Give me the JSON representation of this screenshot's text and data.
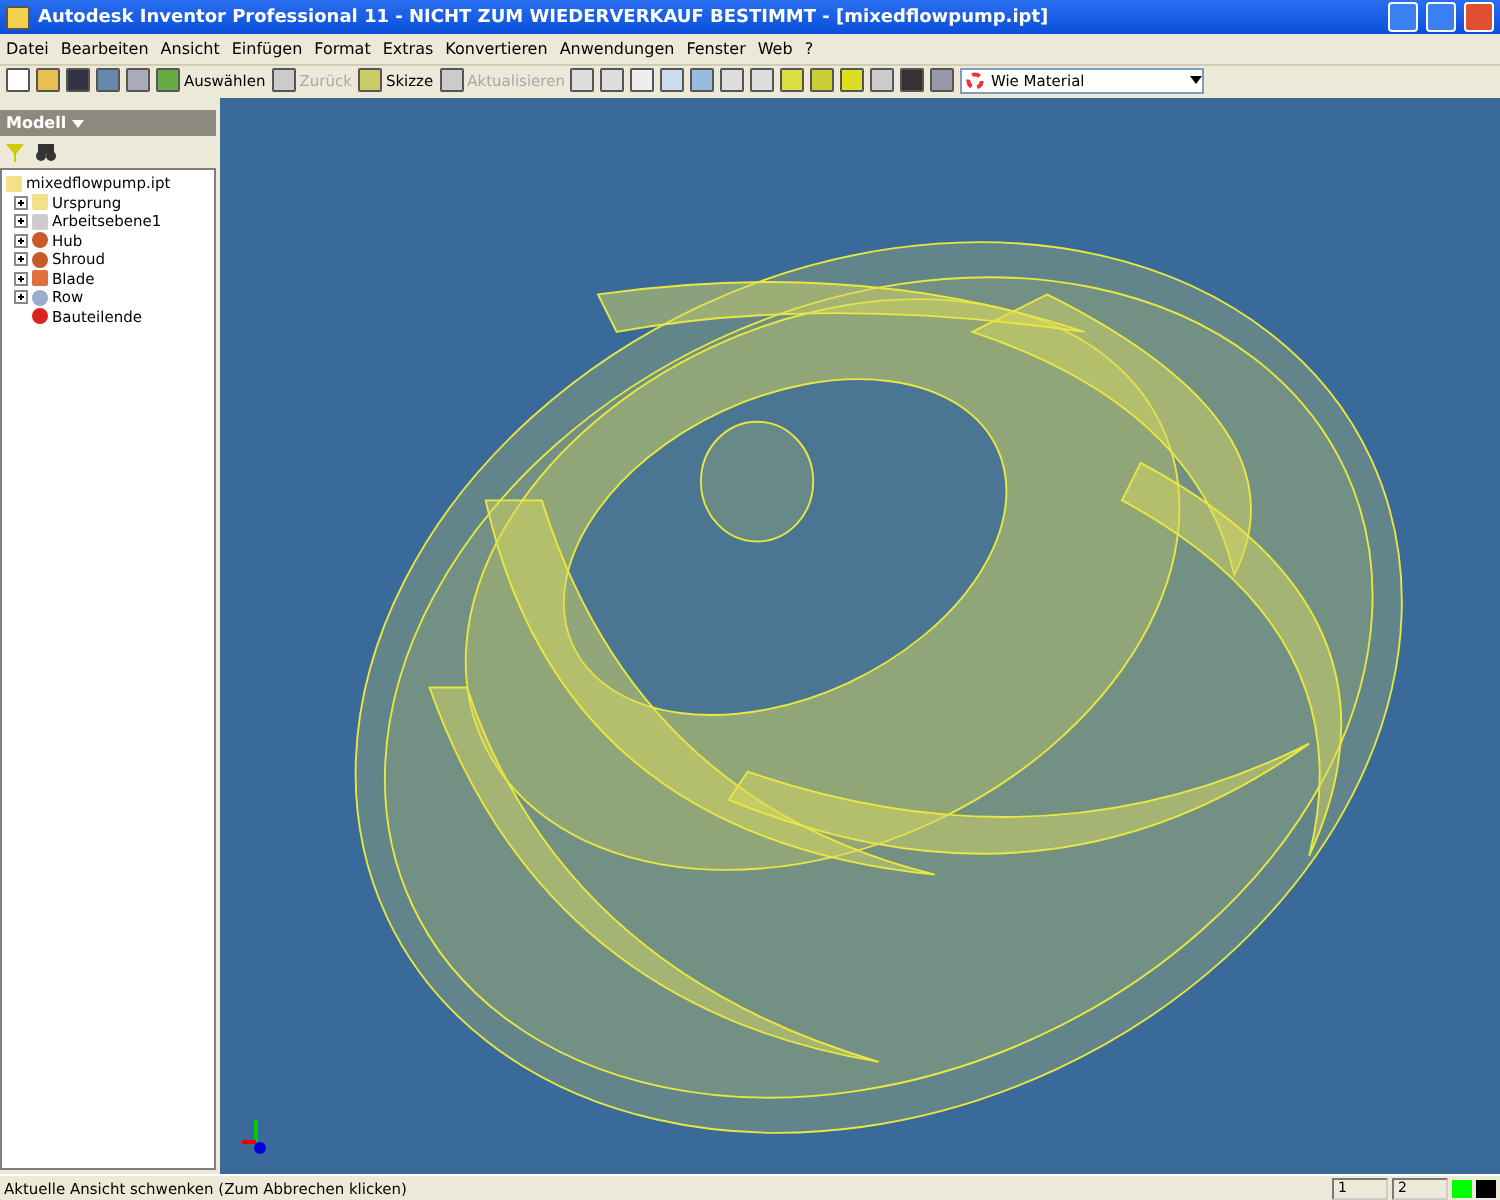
{
  "window": {
    "title": "Autodesk Inventor Professional 11 - NICHT ZUM WIEDERVERKAUF BESTIMMT - [mixedflowpump.ipt]"
  },
  "menu": [
    "Datei",
    "Bearbeiten",
    "Ansicht",
    "Einfügen",
    "Format",
    "Extras",
    "Konvertieren",
    "Anwendungen",
    "Fenster",
    "Web",
    "?"
  ],
  "toolbar": [
    {
      "kind": "new"
    },
    {
      "kind": "open"
    },
    {
      "kind": "save"
    },
    {
      "kind": "undo"
    },
    {
      "kind": "redo"
    },
    {
      "kind": "select",
      "label": "Auswählen",
      "disabled": false
    },
    {
      "kind": "back",
      "label": "Zurück",
      "disabled": true
    },
    {
      "kind": "sketch",
      "label": "Skizze",
      "disabled": false
    },
    {
      "kind": "update",
      "label": "Aktualisieren",
      "disabled": true
    },
    {
      "kind": "zoomall"
    },
    {
      "kind": "zoomwin"
    },
    {
      "kind": "pan"
    },
    {
      "kind": "orbit"
    },
    {
      "kind": "zoom"
    },
    {
      "kind": "look"
    },
    {
      "kind": "home"
    },
    {
      "kind": "box"
    },
    {
      "kind": "shade"
    },
    {
      "kind": "plane"
    },
    {
      "kind": "tree"
    },
    {
      "kind": "cam"
    },
    {
      "kind": "color"
    }
  ],
  "material": {
    "value": "Wie Material"
  },
  "panel": {
    "title": "Modell",
    "tree": {
      "label": "mixedflowpump.ipt",
      "children": [
        {
          "label": "Ursprung",
          "kind": "folder",
          "expander": true
        },
        {
          "label": "Arbeitsebene1",
          "kind": "plane",
          "expander": true
        },
        {
          "label": "Hub",
          "kind": "solid",
          "expander": true
        },
        {
          "label": "Shroud",
          "kind": "solid",
          "expander": true
        },
        {
          "label": "Blade",
          "kind": "blade",
          "expander": true
        },
        {
          "label": "Row",
          "kind": "pattern",
          "expander": true
        },
        {
          "label": "Bauteilende",
          "kind": "end",
          "expander": false
        }
      ]
    }
  },
  "status_bar": {
    "text": "Aktuelle Ansicht schwenken (Zum Abbrechen klicken)",
    "fields": [
      "1",
      "2"
    ]
  }
}
